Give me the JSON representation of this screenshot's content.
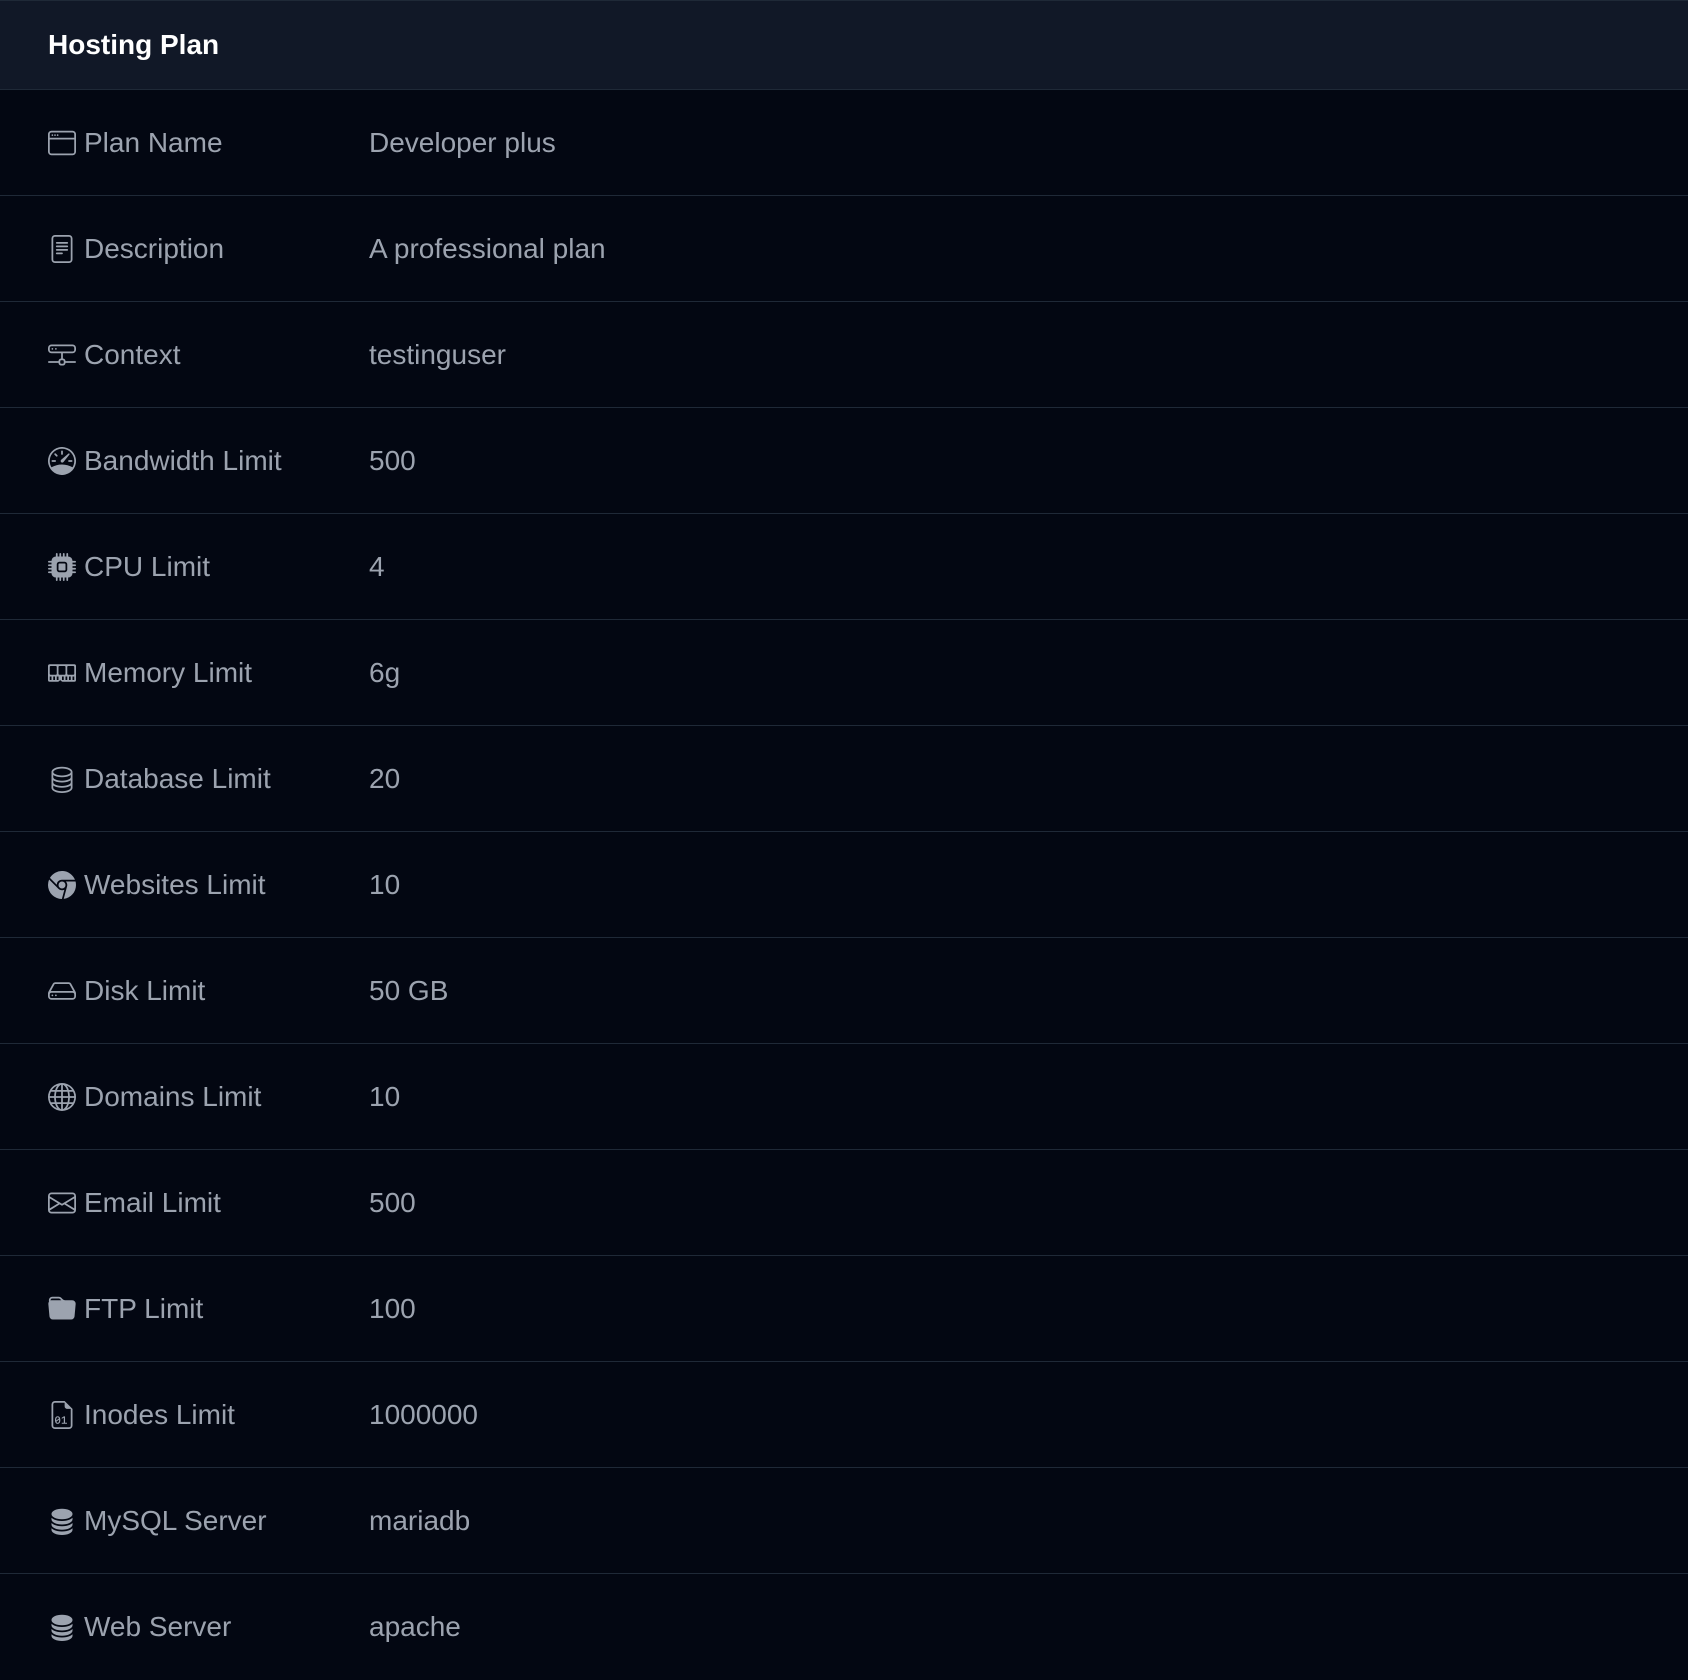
{
  "title": "Hosting Plan",
  "colors": {
    "background": "#030712",
    "header_background": "#111827",
    "border": "#1f2937",
    "title_text": "#ffffff",
    "body_text": "#9ca3af"
  },
  "rows": [
    {
      "label": "Plan Name",
      "value": "Developer plus",
      "icon": "window-icon"
    },
    {
      "label": "Description",
      "value": "A professional plan",
      "icon": "document-icon"
    },
    {
      "label": "Context",
      "value": "testinguser",
      "icon": "network-icon"
    },
    {
      "label": "Bandwidth Limit",
      "value": "500",
      "icon": "speedometer-icon"
    },
    {
      "label": "CPU Limit",
      "value": "4",
      "icon": "cpu-icon"
    },
    {
      "label": "Memory Limit",
      "value": "6g",
      "icon": "memory-icon"
    },
    {
      "label": "Database Limit",
      "value": "20",
      "icon": "database-icon"
    },
    {
      "label": "Websites Limit",
      "value": "10",
      "icon": "chrome-icon"
    },
    {
      "label": "Disk Limit",
      "value": "50 GB",
      "icon": "hard-drive-icon"
    },
    {
      "label": "Domains Limit",
      "value": "10",
      "icon": "globe-icon"
    },
    {
      "label": "Email Limit",
      "value": "500",
      "icon": "envelope-icon"
    },
    {
      "label": "FTP Limit",
      "value": "100",
      "icon": "folder-icon"
    },
    {
      "label": "Inodes Limit",
      "value": "1000000",
      "icon": "binary-file-icon"
    },
    {
      "label": "MySQL Server",
      "value": "mariadb",
      "icon": "database-fill-icon"
    },
    {
      "label": "Web Server",
      "value": "apache",
      "icon": "database-fill-icon"
    }
  ]
}
